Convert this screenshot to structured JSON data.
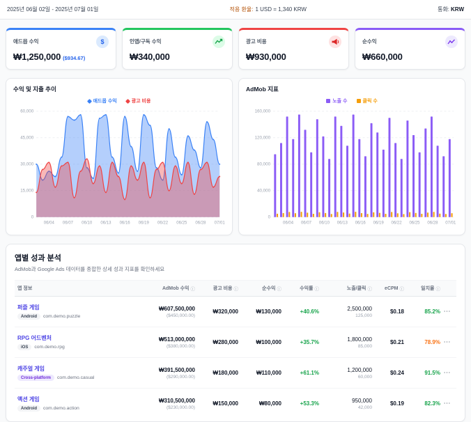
{
  "topbar": {
    "date_range": "2025년 06월 02일 - 2025년 07월 01일",
    "exchange_label": "적용 환율:",
    "exchange_value": "1 USD = 1,340 KRW",
    "currency_label": "통화:",
    "currency_value": "KRW"
  },
  "stat_cards": [
    {
      "label": "애드몹 수익",
      "value": "₩1,250,000",
      "sub": "($934.67)",
      "accent": "#3b82f6",
      "style": "--accent:#3b82f6;--icon-bg:#dbeafe;--icon-fg:#2563eb"
    },
    {
      "label": "인앱/구독 수익",
      "value": "₩340,000",
      "accent": "#22c55e",
      "style": "--accent:#22c55e;--icon-bg:#dcfce7;--icon-fg:#16a34a"
    },
    {
      "label": "광고 비용",
      "value": "₩930,000",
      "accent": "#ef4444",
      "style": "--accent:#ef4444;--icon-bg:#fee2e2;--icon-fg:#dc2626"
    },
    {
      "label": "순수익",
      "value": "₩660,000",
      "accent": "#8b5cf6",
      "style": "--accent:#8b5cf6;--icon-bg:#ede9fe;--icon-fg:#7c3aed"
    }
  ],
  "chart_data": [
    {
      "type": "area",
      "title": "수익 및 지출 추이",
      "x": [
        "06/02",
        "06/03",
        "06/04",
        "06/05",
        "06/06",
        "06/07",
        "06/08",
        "06/09",
        "06/10",
        "06/11",
        "06/12",
        "06/13",
        "06/14",
        "06/15",
        "06/16",
        "06/17",
        "06/18",
        "06/19",
        "06/20",
        "06/21",
        "06/22",
        "06/23",
        "06/24",
        "06/25",
        "06/26",
        "06/27",
        "06/28",
        "06/29",
        "06/30",
        "07/01"
      ],
      "x_ticks": [
        "06/04",
        "06/07",
        "06/10",
        "06/13",
        "06/16",
        "06/19",
        "06/22",
        "06/25",
        "06/28",
        "07/01"
      ],
      "series": [
        {
          "name": "애드몹 수익",
          "color": "#3b82f6",
          "values": [
            30000,
            21000,
            26000,
            23000,
            34000,
            57000,
            55000,
            58000,
            28000,
            22000,
            56000,
            58000,
            34000,
            25000,
            57000,
            40000,
            26000,
            58000,
            52000,
            28000,
            21000,
            50000,
            34000,
            24000,
            46000,
            38000,
            28000,
            54000,
            44000,
            30000
          ]
        },
        {
          "name": "광고 비용",
          "color": "#ef4444",
          "values": [
            14000,
            27000,
            31000,
            17000,
            29000,
            31000,
            11000,
            26000,
            33000,
            19000,
            29000,
            14000,
            31000,
            23000,
            10000,
            29000,
            21000,
            31000,
            11000,
            27000,
            31000,
            15000,
            29000,
            19000,
            31000,
            13000,
            27000,
            31000,
            17000,
            23000
          ]
        }
      ],
      "ylim": [
        0,
        60000
      ],
      "yticks": [
        0,
        15000,
        30000,
        45000,
        60000
      ],
      "grid": true,
      "legend_position": "top"
    },
    {
      "type": "bar",
      "title": "AdMob 지표",
      "x": [
        "06/02",
        "06/03",
        "06/04",
        "06/05",
        "06/06",
        "06/07",
        "06/08",
        "06/09",
        "06/10",
        "06/11",
        "06/12",
        "06/13",
        "06/14",
        "06/15",
        "06/16",
        "06/17",
        "06/18",
        "06/19",
        "06/20",
        "06/21",
        "06/22",
        "06/23",
        "06/24",
        "06/25",
        "06/26",
        "06/27",
        "06/28",
        "06/29",
        "06/30",
        "07/01"
      ],
      "x_ticks": [
        "06/04",
        "06/07",
        "06/10",
        "06/13",
        "06/16",
        "06/19",
        "06/22",
        "06/25",
        "06/28",
        "07/01"
      ],
      "series": [
        {
          "name": "노출 수",
          "color": "#8b5cf6",
          "values": [
            95000,
            112000,
            152000,
            118000,
            155000,
            132000,
            98000,
            148000,
            122000,
            88000,
            152000,
            138000,
            108000,
            155000,
            118000,
            92000,
            142000,
            128000,
            102000,
            150000,
            112000,
            88000,
            146000,
            124000,
            98000,
            134000,
            152000,
            108000,
            92000,
            118000
          ]
        },
        {
          "name": "클릭 수",
          "color": "#f59e0b",
          "values": [
            5200,
            6100,
            7800,
            6000,
            8000,
            6800,
            5000,
            7400,
            6200,
            4800,
            7900,
            7000,
            5400,
            8100,
            6100,
            4900,
            7300,
            6500,
            5100,
            7800,
            5800,
            4600,
            7500,
            6300,
            5000,
            6900,
            7900,
            5300,
            4800,
            6000
          ]
        }
      ],
      "ylim": [
        0,
        160000
      ],
      "yticks": [
        0,
        40000,
        80000,
        120000,
        160000
      ],
      "grid": true,
      "legend_position": "top"
    }
  ],
  "table": {
    "title": "앱별 성과 분석",
    "subtitle": "AdMob과 Google Ads 데이터를 종합한 상세 성과 지표를 확인하세요",
    "columns": [
      "앱 정보",
      "AdMob 수익",
      "광고 비용",
      "순수익",
      "수익률",
      "노출/클릭",
      "eCPM",
      "일치율",
      ""
    ],
    "menu_glyph": "⋯",
    "info_glyph": "ⓘ",
    "rows": [
      {
        "app_name": "퍼즐 게임",
        "platform": "Android",
        "platform_bg": "#f3f4f6",
        "platform_fg": "#374151",
        "package": "com.demo.puzzle",
        "admob_krw": "₩607,500,000",
        "admob_usd": "($450,000.00)",
        "ad_cost": "₩320,000",
        "net": "₩130,000",
        "roi": "+40.6%",
        "roi_color": "#16a34a",
        "impressions": "2,500,000",
        "clicks": "125,000",
        "ecpm": "$0.18",
        "match": "85.2%",
        "match_color": "#16a34a"
      },
      {
        "app_name": "RPG 어드벤처",
        "platform": "iOS",
        "platform_bg": "#f3f4f6",
        "platform_fg": "#374151",
        "package": "com.demo.rpg",
        "admob_krw": "₩513,000,000",
        "admob_usd": "($380,000.00)",
        "ad_cost": "₩280,000",
        "net": "₩100,000",
        "roi": "+35.7%",
        "roi_color": "#16a34a",
        "impressions": "1,800,000",
        "clicks": "85,000",
        "ecpm": "$0.21",
        "match": "78.9%",
        "match_color": "#f97316"
      },
      {
        "app_name": "캐주얼 게임",
        "platform": "Cross-platform",
        "platform_bg": "#ede9fe",
        "platform_fg": "#6d28d9",
        "package": "com.demo.casual",
        "admob_krw": "₩391,500,000",
        "admob_usd": "($290,000.00)",
        "ad_cost": "₩180,000",
        "net": "₩110,000",
        "roi": "+61.1%",
        "roi_color": "#16a34a",
        "impressions": "1,200,000",
        "clicks": "60,000",
        "ecpm": "$0.24",
        "match": "91.5%",
        "match_color": "#16a34a"
      },
      {
        "app_name": "액션 게임",
        "platform": "Android",
        "platform_bg": "#f3f4f6",
        "platform_fg": "#374151",
        "package": "com.demo.action",
        "admob_krw": "₩310,500,000",
        "admob_usd": "($230,000.00)",
        "ad_cost": "₩150,000",
        "net": "₩80,000",
        "roi": "+53.3%",
        "roi_color": "#16a34a",
        "impressions": "950,000",
        "clicks": "42,000",
        "ecpm": "$0.19",
        "match": "82.3%",
        "match_color": "#16a34a"
      }
    ]
  }
}
